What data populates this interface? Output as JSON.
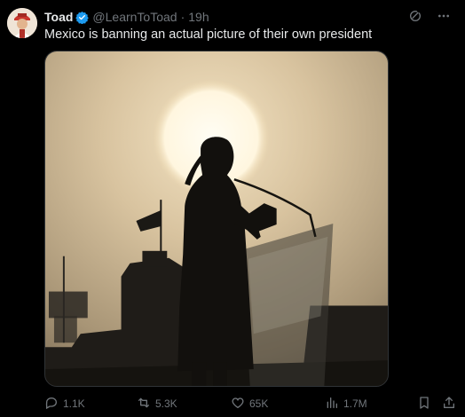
{
  "tweet": {
    "author_name": "Toad",
    "handle": "@LearnToToad",
    "separator": "·",
    "time": "19h",
    "text": "Mexico is banning an actual picture of their own president"
  },
  "actions": {
    "replies": "1.1K",
    "reposts": "5.3K",
    "likes": "65K",
    "views": "1.7M"
  },
  "icons": {
    "verified": "verified-badge-icon",
    "grok": "grok-icon",
    "more": "more-options-icon",
    "reply": "reply-icon",
    "repost": "repost-icon",
    "like": "like-icon",
    "views": "views-icon",
    "bookmark": "bookmark-icon",
    "share": "share-icon"
  },
  "colors": {
    "background": "#000000",
    "text": "#e7e9ea",
    "muted": "#71767b",
    "verified": "#1d9bf0"
  }
}
